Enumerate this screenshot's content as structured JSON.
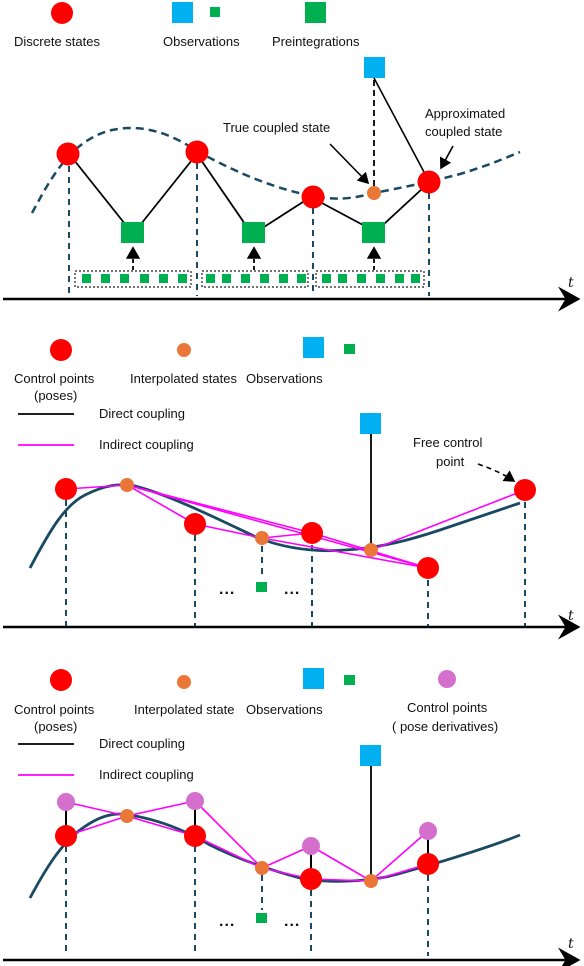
{
  "colors": {
    "pose": "#ff0000",
    "interp": "#ea7637",
    "obs_big": "#00b0f0",
    "obs_small": "#00b050",
    "preint": "#00b050",
    "derivative": "#d56fcd",
    "curve": "#1a4a63",
    "direct": "#000000",
    "indirect": "#ff00ff"
  },
  "panel1": {
    "legend": {
      "discrete_states": "Discrete states",
      "observations": "Observations",
      "preintegrations": "Preintegrations"
    },
    "annotations": {
      "true_coupled": "True coupled state",
      "approx_line1": "Approximated",
      "approx_line2": "coupled state"
    },
    "axis_label": "t"
  },
  "panel2": {
    "legend": {
      "control_points_line1": "Control points",
      "control_points_line2": "(poses)",
      "interpolated": "Interpolated states",
      "observations": "Observations",
      "direct": "Direct coupling",
      "indirect": "Indirect coupling"
    },
    "annotations": {
      "free_line1": "Free control",
      "free_line2": "point"
    },
    "ellipsis": "...",
    "axis_label": "t"
  },
  "panel3": {
    "legend": {
      "control_points_line1": "Control points",
      "control_points_line2": "(poses)",
      "interpolated": "Interpolated state",
      "observations": "Observations",
      "derivatives_line1": "Control points",
      "derivatives_line2": "( pose derivatives)",
      "direct": "Direct coupling",
      "indirect": "Indirect coupling"
    },
    "ellipsis": "...",
    "axis_label": "t"
  }
}
